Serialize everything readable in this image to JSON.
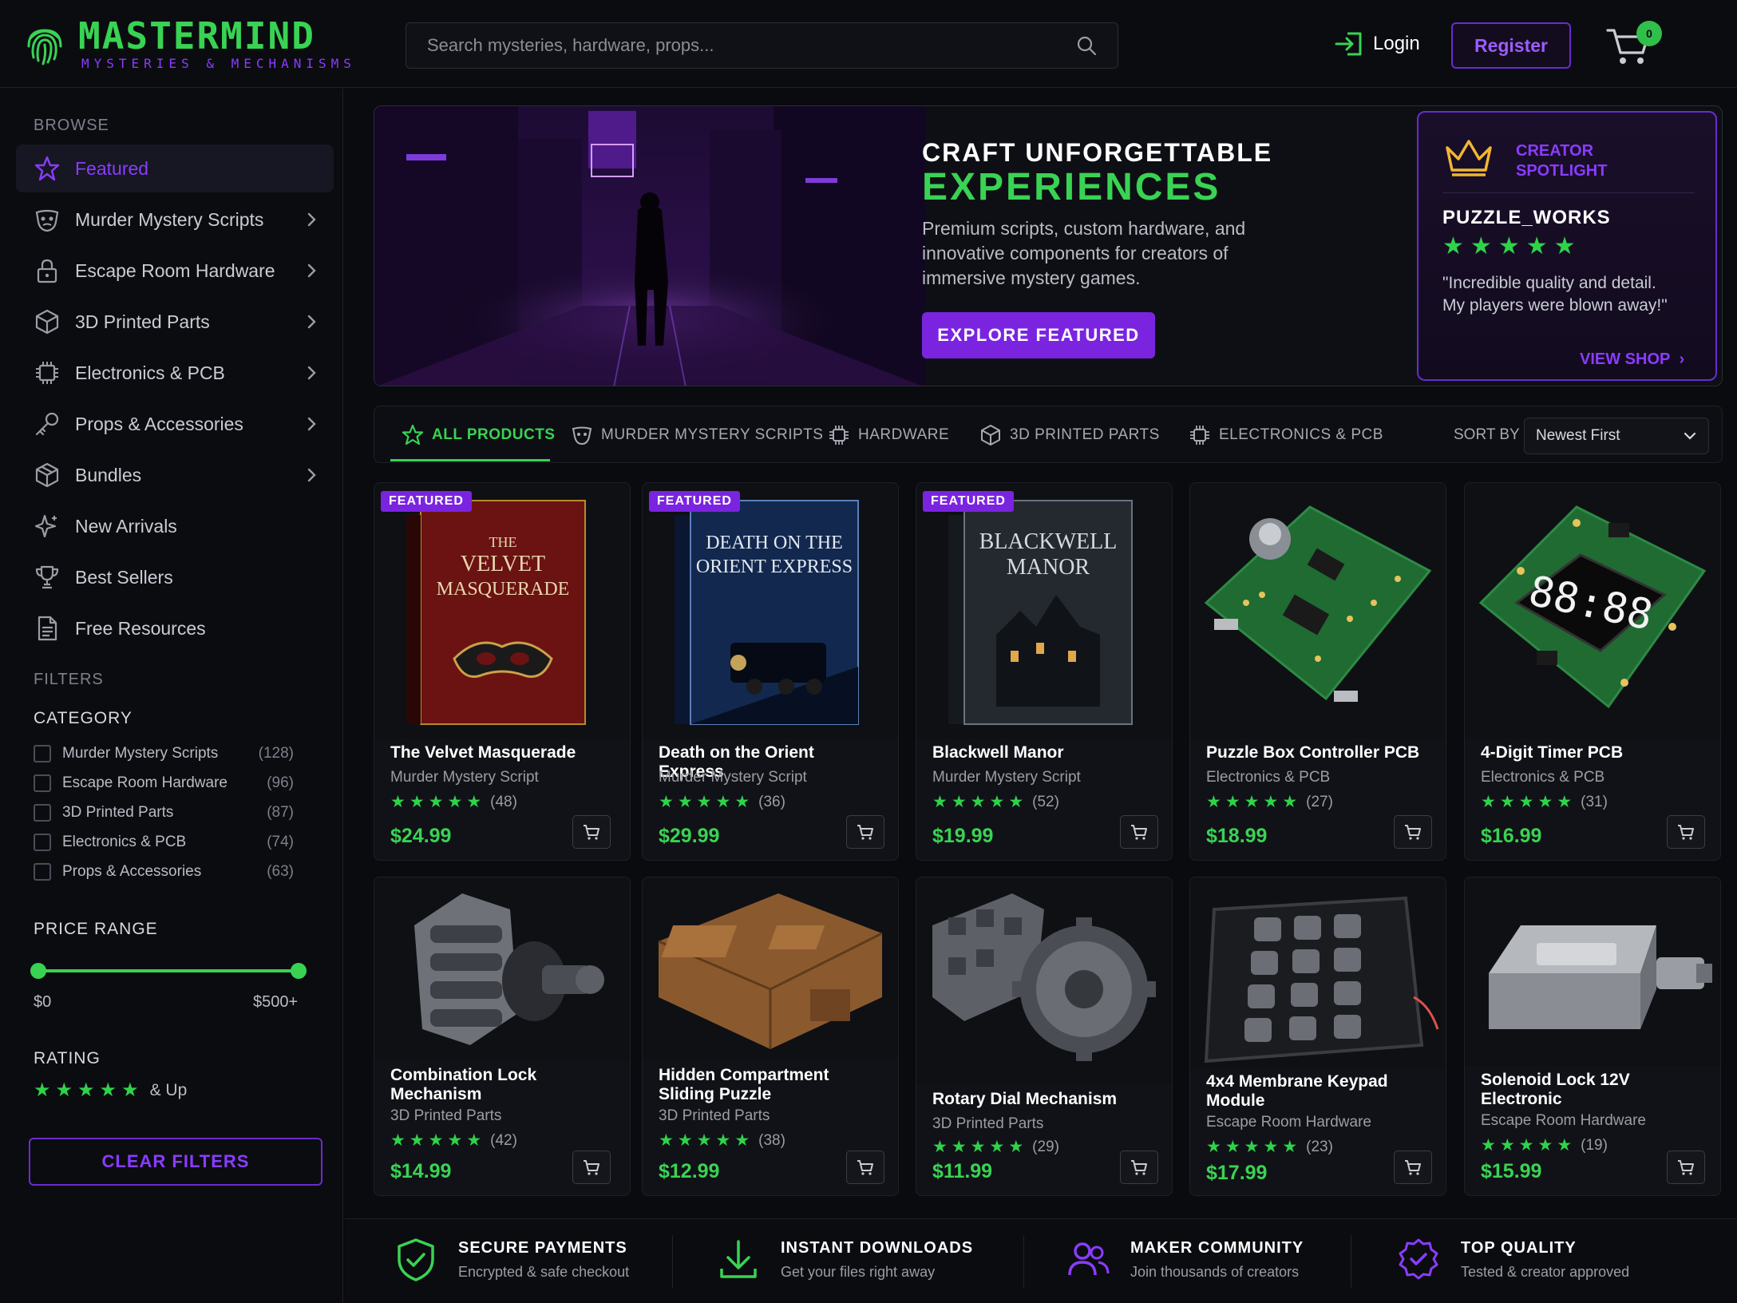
{
  "brand": {
    "title": "MASTERMIND",
    "subtitle": "MYSTERIES & MECHANISMS"
  },
  "header": {
    "search_placeholder": "Search mysteries, hardware, props...",
    "login": "Login",
    "register": "Register",
    "cart_count": "0"
  },
  "colors": {
    "accent_green": "#39d353",
    "accent_purple": "#7a24e0",
    "background": "#0a0b0e"
  },
  "sidebar": {
    "browse_heading": "BROWSE",
    "items": [
      {
        "label": "Featured",
        "icon": "star-icon",
        "active": true
      },
      {
        "label": "Murder Mystery Scripts",
        "icon": "mask-icon"
      },
      {
        "label": "Escape Room Hardware",
        "icon": "lock-icon"
      },
      {
        "label": "3D Printed Parts",
        "icon": "cube-icon"
      },
      {
        "label": "Electronics & PCB",
        "icon": "chip-icon"
      },
      {
        "label": "Props & Accessories",
        "icon": "key-icon"
      },
      {
        "label": "Bundles",
        "icon": "box-icon"
      },
      {
        "label": "New Arrivals",
        "icon": "sparkle-icon"
      },
      {
        "label": "Best Sellers",
        "icon": "trophy-icon"
      },
      {
        "label": "Free Resources",
        "icon": "document-icon"
      }
    ],
    "filters_heading": "FILTERS",
    "category_heading": "CATEGORY",
    "categories": [
      {
        "label": "Murder Mystery Scripts",
        "count": "(128)"
      },
      {
        "label": "Escape Room Hardware",
        "count": "(96)"
      },
      {
        "label": "3D Printed Parts",
        "count": "(87)"
      },
      {
        "label": "Electronics & PCB",
        "count": "(74)"
      },
      {
        "label": "Props & Accessories",
        "count": "(63)"
      }
    ],
    "price_heading": "PRICE RANGE",
    "price_min": "$0",
    "price_max": "$500+",
    "rating_heading": "RATING",
    "rating_suffix": "& Up",
    "clear_filters": "CLEAR FILTERS"
  },
  "hero": {
    "kicker": "CRAFT UNFORGETTABLE",
    "title": "EXPERIENCES",
    "description": "Premium scripts, custom hardware, and innovative components for creators of immersive mystery games.",
    "button": "EXPLORE FEATURED",
    "spotlight": {
      "label": "CREATOR SPOTLIGHT",
      "name": "PUZZLE_WORKS",
      "rating": 5,
      "quote": "\"Incredible quality and detail. My players were blown away!\"",
      "link": "VIEW SHOP"
    }
  },
  "tabs": [
    {
      "label": "ALL PRODUCTS",
      "icon": "star-icon",
      "active": true
    },
    {
      "label": "MURDER MYSTERY SCRIPTS",
      "icon": "mask-icon"
    },
    {
      "label": "HARDWARE",
      "icon": "chip-icon"
    },
    {
      "label": "3D PRINTED PARTS",
      "icon": "cube-icon"
    },
    {
      "label": "ELECTRONICS & PCB",
      "icon": "chip-icon"
    }
  ],
  "sort": {
    "label": "SORT BY",
    "value": "Newest First"
  },
  "products": [
    {
      "name": "The Velvet Masquerade",
      "category": "Murder Mystery Script",
      "rating": 5,
      "reviews": "(48)",
      "price": "$24.99",
      "badge": "FEATURED",
      "cover_title": "THE VELVET MASQUERADE"
    },
    {
      "name": "Death on the Orient Express",
      "category": "Murder Mystery Script",
      "rating": 5,
      "reviews": "(36)",
      "price": "$29.99",
      "badge": "FEATURED",
      "cover_title": "DEATH ON THE ORIENT EXPRESS"
    },
    {
      "name": "Blackwell Manor",
      "category": "Murder Mystery Script",
      "rating": 5,
      "reviews": "(52)",
      "price": "$19.99",
      "badge": "FEATURED",
      "cover_title": "BLACKWELL MANOR"
    },
    {
      "name": "Puzzle Box Controller PCB",
      "category": "Electronics & PCB",
      "rating": 5,
      "reviews": "(27)",
      "price": "$18.99"
    },
    {
      "name": "4-Digit Timer PCB",
      "category": "Electronics & PCB",
      "rating": 5,
      "reviews": "(31)",
      "price": "$16.99",
      "display": "88:88"
    },
    {
      "name": "Combination Lock Mechanism",
      "category": "3D Printed Parts",
      "rating": 5,
      "reviews": "(42)",
      "price": "$14.99"
    },
    {
      "name": "Hidden Compartment Sliding Puzzle",
      "category": "3D Printed Parts",
      "rating": 5,
      "reviews": "(38)",
      "price": "$12.99"
    },
    {
      "name": "Rotary Dial Mechanism",
      "category": "3D Printed Parts",
      "rating": 5,
      "reviews": "(29)",
      "price": "$11.99"
    },
    {
      "name": "4x4 Membrane Keypad Module",
      "category": "Escape Room Hardware",
      "rating": 5,
      "reviews": "(23)",
      "price": "$17.99"
    },
    {
      "name": "Solenoid Lock 12V Electronic",
      "category": "Escape Room Hardware",
      "rating": 5,
      "reviews": "(19)",
      "price": "$15.99"
    }
  ],
  "footer": [
    {
      "title": "SECURE PAYMENTS",
      "subtitle": "Encrypted & safe checkout",
      "icon": "shield-check-icon"
    },
    {
      "title": "INSTANT DOWNLOADS",
      "subtitle": "Get your files right away",
      "icon": "download-icon"
    },
    {
      "title": "MAKER COMMUNITY",
      "subtitle": "Join thousands of creators",
      "icon": "users-icon"
    },
    {
      "title": "TOP QUALITY",
      "subtitle": "Tested & creator approved",
      "icon": "award-icon"
    }
  ]
}
